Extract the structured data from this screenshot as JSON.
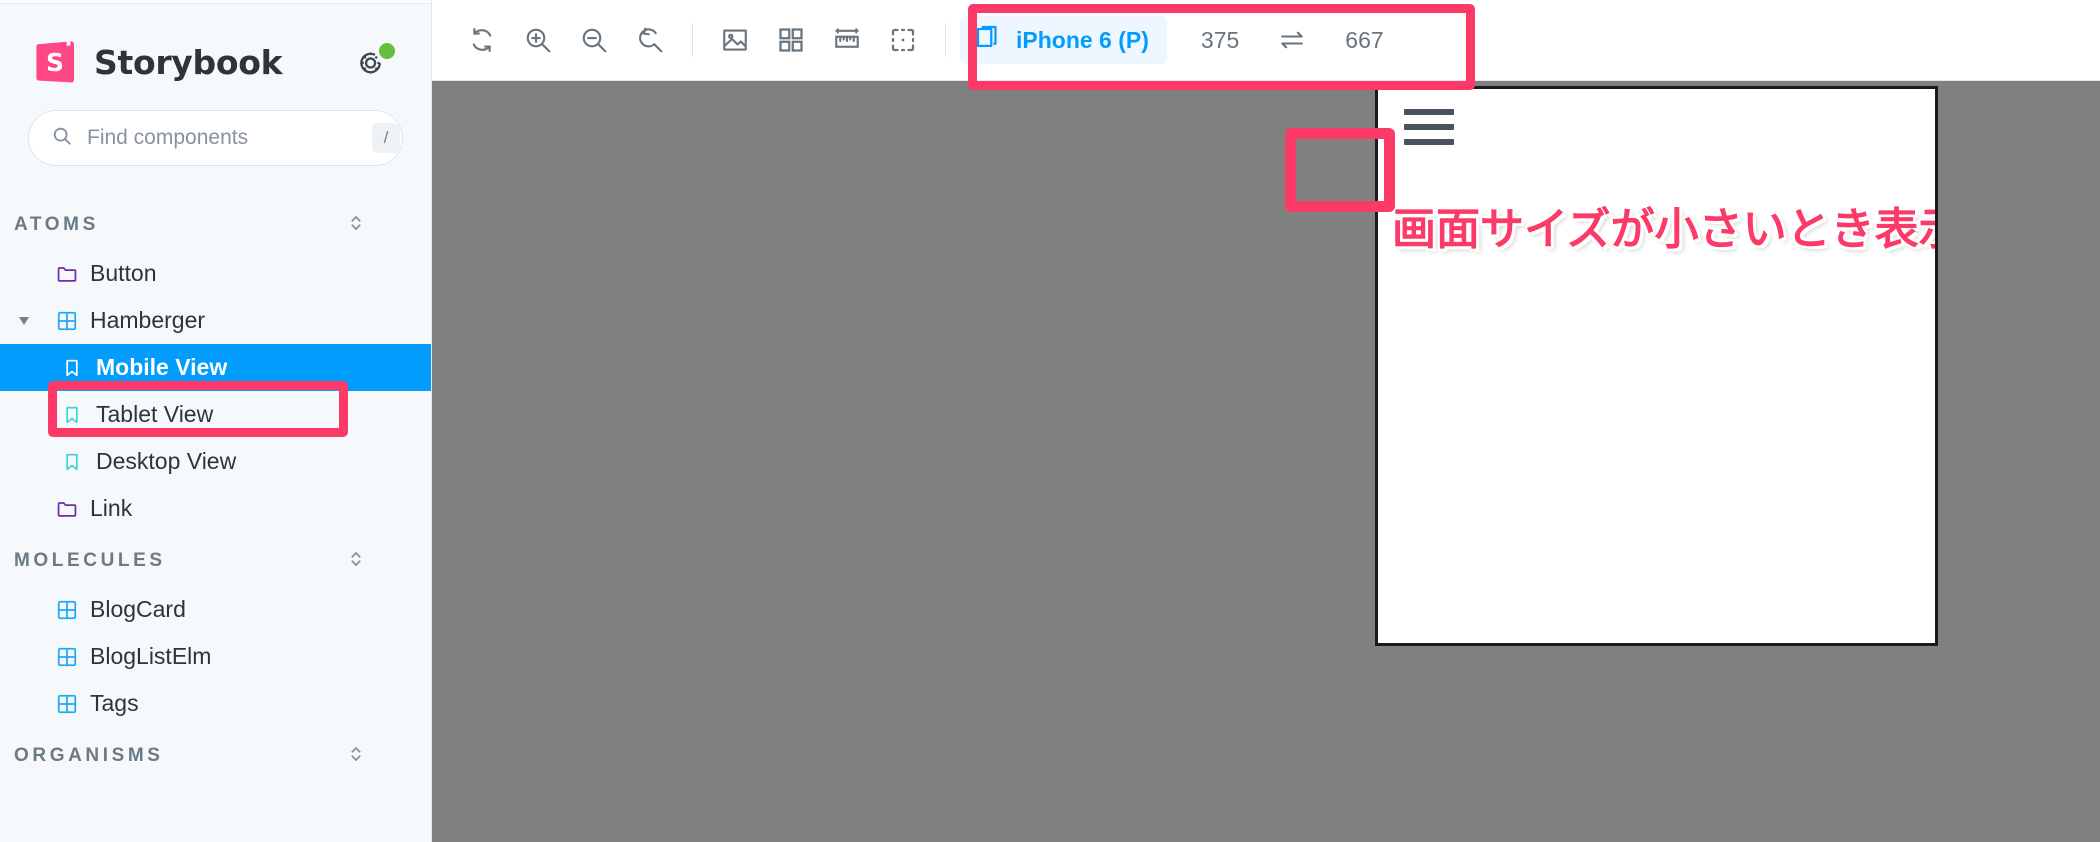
{
  "app": {
    "brand": "Storybook",
    "brand_logo_icon": "storybook-logo-icon",
    "status_icon": "gear-icon",
    "accent_blue": "#029cfd",
    "accent_pink": "#fb3a68",
    "canvas_bg": "#808080"
  },
  "search": {
    "placeholder": "Find components",
    "value": "",
    "shortcut_key": "/",
    "icon": "search-icon"
  },
  "sidebar": {
    "sections": [
      {
        "label": "ATOMS",
        "collapse_icon": "chevron-updown-icon",
        "items": [
          {
            "label": "Button",
            "icon": "folder-icon",
            "depth": 0,
            "expandable": false,
            "selected": false
          },
          {
            "label": "Hamberger",
            "icon": "component-icon",
            "depth": 0,
            "expandable": true,
            "expanded": true,
            "selected": false
          },
          {
            "label": "Mobile View",
            "icon": "story-icon",
            "depth": 1,
            "expandable": false,
            "selected": true
          },
          {
            "label": "Tablet View",
            "icon": "story-icon",
            "depth": 1,
            "expandable": false,
            "selected": false
          },
          {
            "label": "Desktop View",
            "icon": "story-icon",
            "depth": 1,
            "expandable": false,
            "selected": false
          },
          {
            "label": "Link",
            "icon": "folder-icon",
            "depth": 0,
            "expandable": false,
            "selected": false
          }
        ]
      },
      {
        "label": "MOLECULES",
        "collapse_icon": "chevron-updown-icon",
        "items": [
          {
            "label": "BlogCard",
            "icon": "component-icon",
            "depth": 0,
            "expandable": false,
            "selected": false
          },
          {
            "label": "BlogListElm",
            "icon": "component-icon",
            "depth": 0,
            "expandable": false,
            "selected": false
          },
          {
            "label": "Tags",
            "icon": "component-icon",
            "depth": 0,
            "expandable": false,
            "selected": false
          }
        ]
      },
      {
        "label": "ORGANISMS",
        "collapse_icon": "chevron-updown-icon",
        "items": []
      }
    ]
  },
  "toolbar": {
    "buttons": [
      {
        "name": "remount-button",
        "icon": "refresh-icon",
        "title": "Remount component"
      },
      {
        "name": "zoom-in-button",
        "icon": "zoom-in-icon",
        "title": "Zoom in"
      },
      {
        "name": "zoom-out-button",
        "icon": "zoom-out-icon",
        "title": "Zoom out"
      },
      {
        "name": "zoom-reset-button",
        "icon": "zoom-reset-icon",
        "title": "Reset zoom"
      },
      {
        "name": "backgrounds-button",
        "icon": "image-icon",
        "title": "Change background"
      },
      {
        "name": "grid-button",
        "icon": "grid-icon",
        "title": "Apply grid"
      },
      {
        "name": "measure-button",
        "icon": "ruler-icon",
        "title": "Enable measure"
      },
      {
        "name": "outline-button",
        "icon": "outline-icon",
        "title": "Apply outlines"
      }
    ],
    "viewport": {
      "icon": "viewport-icon",
      "label": "iPhone 6 (P)",
      "width": "375",
      "height": "667",
      "swap_icon": "swap-arrows-icon"
    }
  },
  "preview": {
    "hamburger_icon": "hamburger-menu-icon",
    "note_text": "画面サイズが小さいとき表示"
  },
  "annotations": [
    {
      "name": "annotation-viewport-highlight",
      "target": "viewport selector"
    },
    {
      "name": "annotation-selected-story-highlight",
      "target": "Mobile View story"
    },
    {
      "name": "annotation-hamburger-highlight",
      "target": "hamburger icon in preview"
    }
  ]
}
